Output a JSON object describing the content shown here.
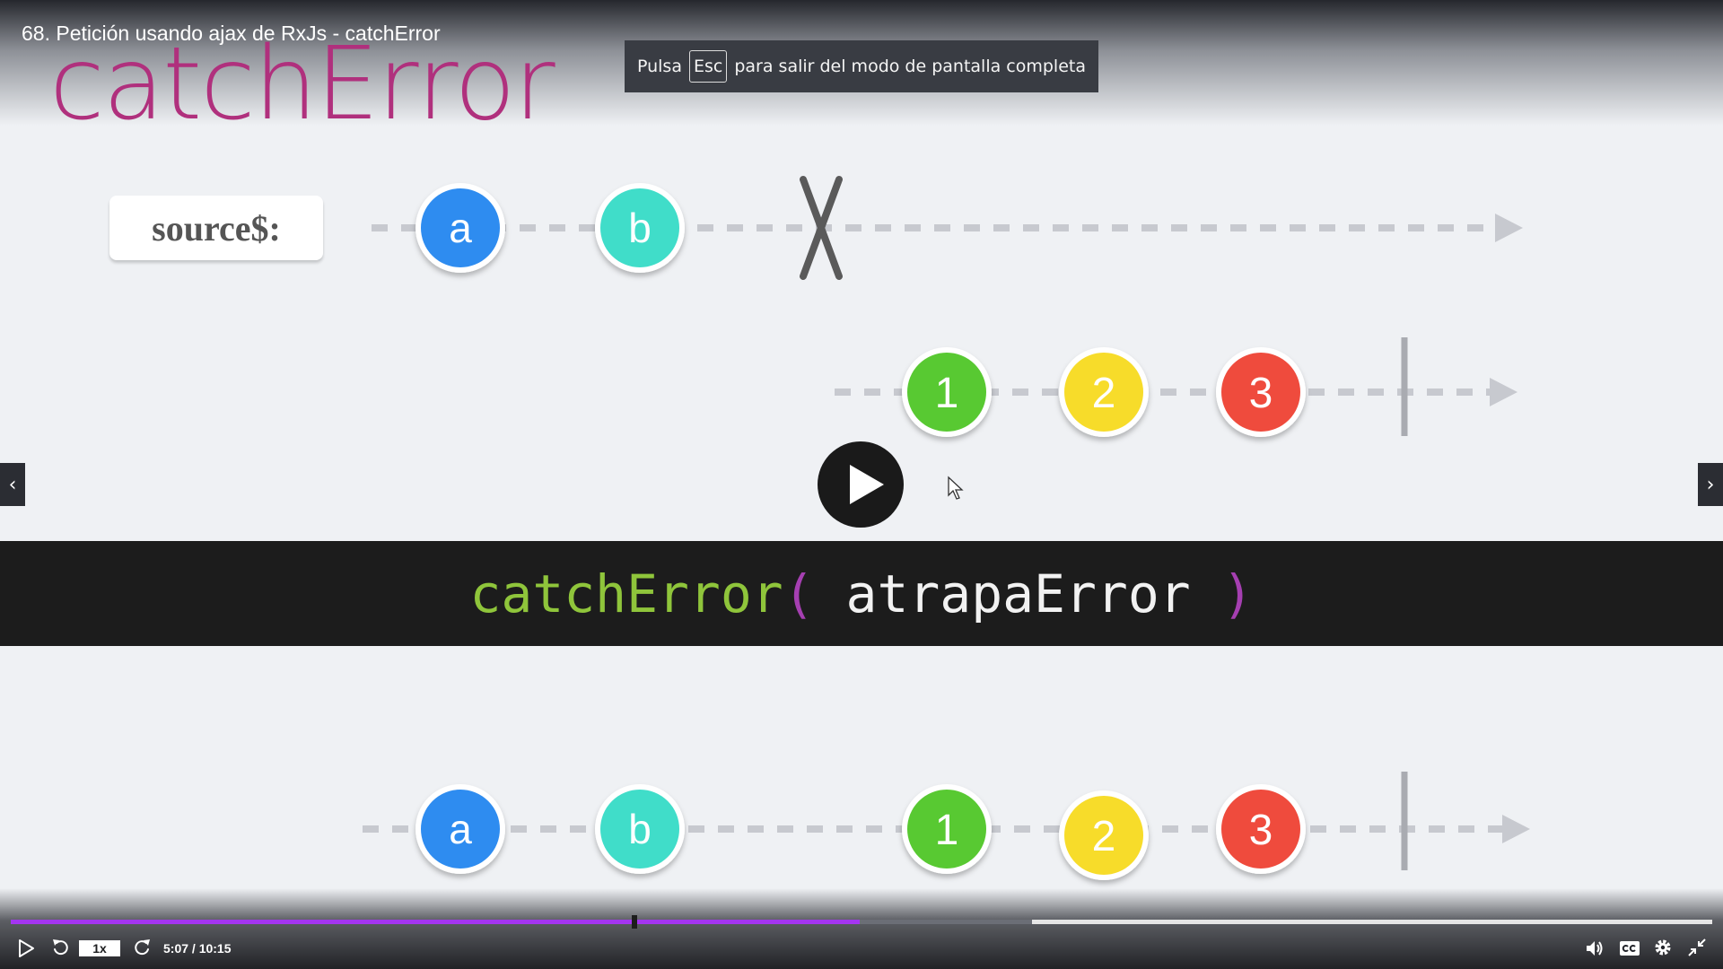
{
  "video": {
    "title": "68. Petición usando ajax de RxJs - catchError"
  },
  "slide": {
    "title": "catchError",
    "source_label": "source$:",
    "code": {
      "fn": "catchError",
      "open": "(",
      "arg": " atrapaError ",
      "close": ")"
    },
    "marbles": {
      "a": "a",
      "b": "b",
      "one": "1",
      "two": "2",
      "three": "3"
    }
  },
  "fullscreen_notice": {
    "before": "Pulsa",
    "key": "Esc",
    "after": "para salir del modo de pantalla completa"
  },
  "navigation": {
    "prev_glyph": "‹",
    "next_glyph": "›"
  },
  "player": {
    "speed": "1x",
    "time": "5:07 / 10:15",
    "progress_fraction": 0.499,
    "buffered_fraction": 0.6
  },
  "colors": {
    "accent": "#a435f0",
    "title_magenta": "#b0307d",
    "marble_a": "#2d8cf0",
    "marble_b": "#3fddc9",
    "marble_one": "#58c930",
    "marble_two": "#f7dc2c",
    "marble_three": "#ef4c3e"
  },
  "icons": {
    "play": "play-icon",
    "rewind": "rewind-icon",
    "forward": "forward-icon",
    "volume": "volume-icon",
    "captions": "captions-icon",
    "settings": "gear-icon",
    "exit_fullscreen": "exit-fullscreen-icon"
  }
}
